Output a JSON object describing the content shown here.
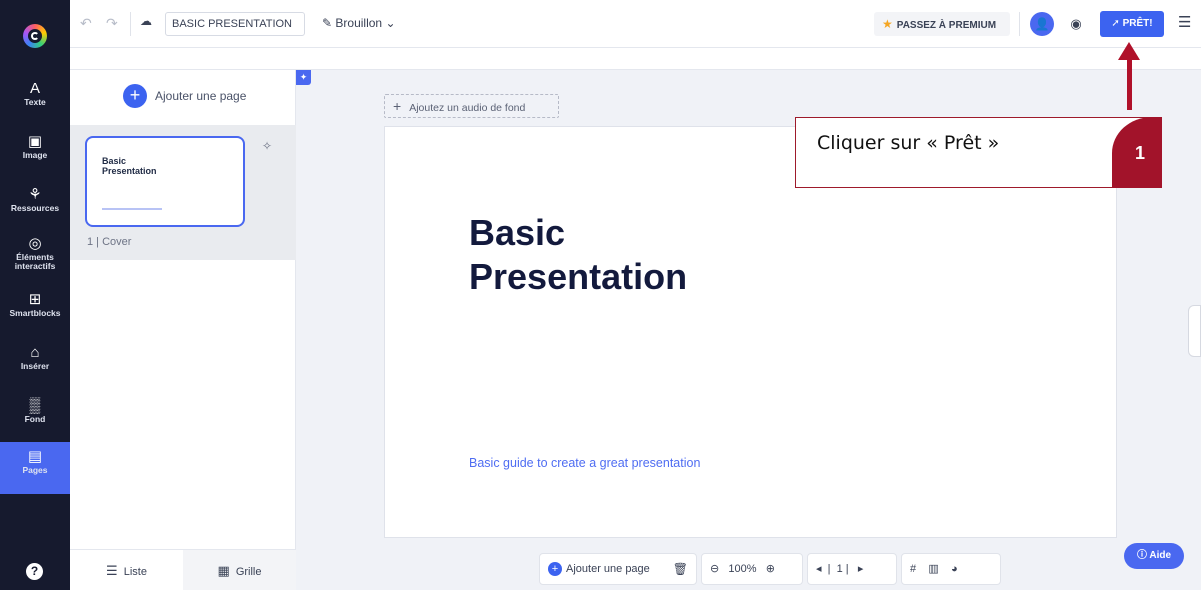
{
  "sidebar": {
    "logo": "genially-logo",
    "items": [
      {
        "label": "Texte",
        "icon": "A"
      },
      {
        "label": "Image",
        "icon": "▣"
      },
      {
        "label": "Ressources",
        "icon": "⚘"
      },
      {
        "label": "Éléments",
        "label2": "interactifs",
        "icon": "◎"
      },
      {
        "label": "Smartblocks",
        "icon": "⊞"
      },
      {
        "label": "Insérer",
        "icon": "⌂"
      },
      {
        "label": "Fond",
        "icon": "▒"
      },
      {
        "label": "Pages",
        "icon": "▤"
      }
    ],
    "help": "?"
  },
  "toolbar": {
    "undo": "↶",
    "redo": "↷",
    "title": "BASIC PRESENTATION",
    "status": "Brouillon",
    "premium": "PASSEZ À PREMIUM",
    "ready": "PRÊT!",
    "menu": "☰"
  },
  "pages_panel": {
    "add_page": "Ajouter une page",
    "pages": [
      {
        "number": "1",
        "name": "Cover",
        "thumb_title": "Basic Presentation"
      }
    ],
    "tab_list": "Liste",
    "tab_grid": "Grille"
  },
  "canvas": {
    "audio": "Ajoutez un audio de fond",
    "slide_title": "Basic Presentation",
    "slide_subtitle": "Basic guide to create a great presentation"
  },
  "bottom_bar": {
    "add_page": "Ajouter une page",
    "zoom": "100%",
    "page": "1"
  },
  "help_button": "Aide",
  "annotation": {
    "text": "Cliquer sur « Prêt »",
    "step": "1"
  }
}
